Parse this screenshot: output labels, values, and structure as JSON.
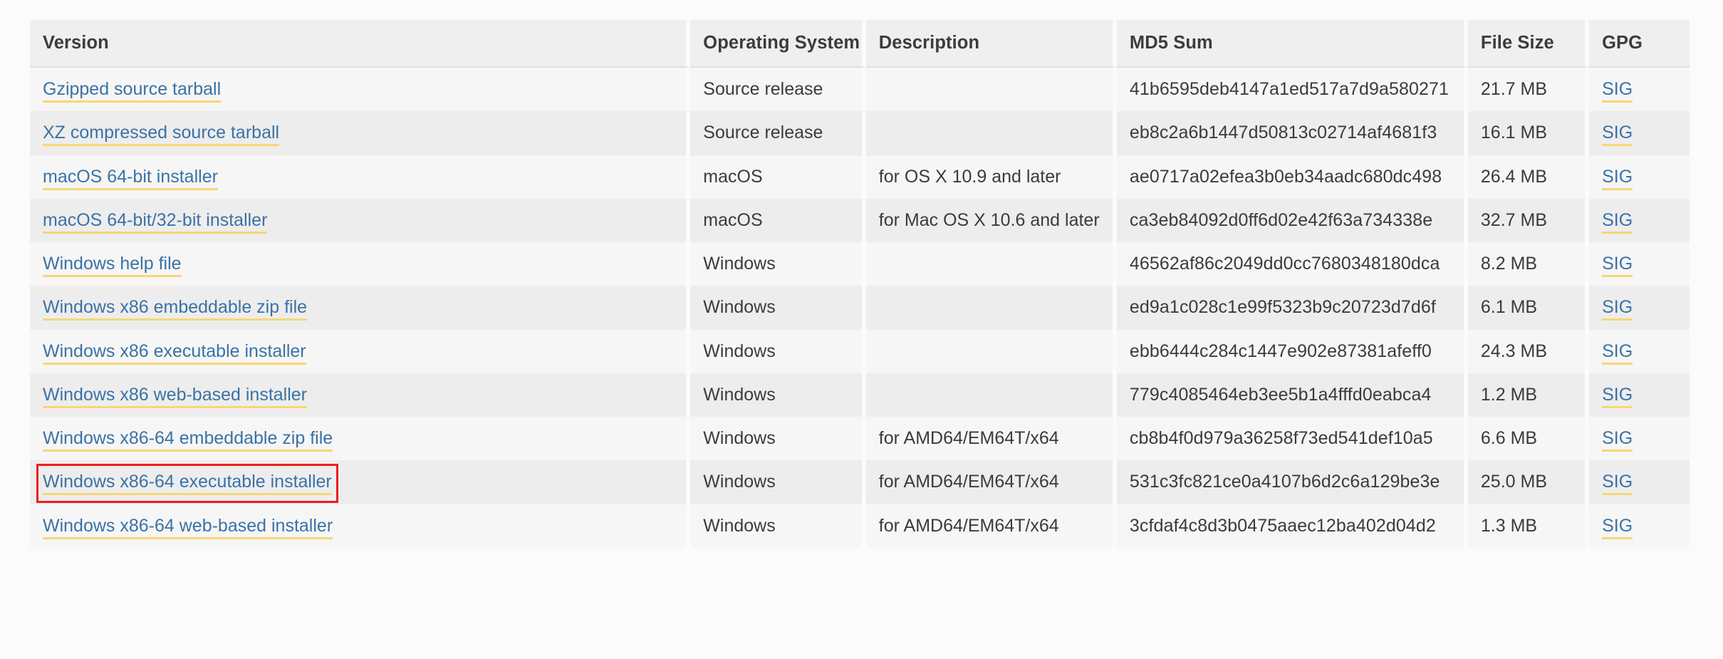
{
  "table": {
    "columns": [
      {
        "key": "version",
        "label": "Version"
      },
      {
        "key": "os",
        "label": "Operating System"
      },
      {
        "key": "description",
        "label": "Description"
      },
      {
        "key": "md5",
        "label": "MD5 Sum"
      },
      {
        "key": "size",
        "label": "File Size"
      },
      {
        "key": "gpg",
        "label": "GPG"
      }
    ],
    "rows": [
      {
        "version": "Gzipped source tarball",
        "os": "Source release",
        "description": "",
        "md5": "41b6595deb4147a1ed517a7d9a580271",
        "size": "21.7 MB",
        "gpg": "SIG"
      },
      {
        "version": "XZ compressed source tarball",
        "os": "Source release",
        "description": "",
        "md5": "eb8c2a6b1447d50813c02714af4681f3",
        "size": "16.1 MB",
        "gpg": "SIG"
      },
      {
        "version": "macOS 64-bit installer",
        "os": "macOS",
        "description": "for OS X 10.9 and later",
        "md5": "ae0717a02efea3b0eb34aadc680dc498",
        "size": "26.4 MB",
        "gpg": "SIG"
      },
      {
        "version": "macOS 64-bit/32-bit installer",
        "os": "macOS",
        "description": "for Mac OS X 10.6 and later",
        "md5": "ca3eb84092d0ff6d02e42f63a734338e",
        "size": "32.7 MB",
        "gpg": "SIG"
      },
      {
        "version": "Windows help file",
        "os": "Windows",
        "description": "",
        "md5": "46562af86c2049dd0cc7680348180dca",
        "size": "8.2 MB",
        "gpg": "SIG"
      },
      {
        "version": "Windows x86 embeddable zip file",
        "os": "Windows",
        "description": "",
        "md5": "ed9a1c028c1e99f5323b9c20723d7d6f",
        "size": "6.1 MB",
        "gpg": "SIG"
      },
      {
        "version": "Windows x86 executable installer",
        "os": "Windows",
        "description": "",
        "md5": "ebb6444c284c1447e902e87381afeff0",
        "size": "24.3 MB",
        "gpg": "SIG"
      },
      {
        "version": "Windows x86 web-based installer",
        "os": "Windows",
        "description": "",
        "md5": "779c4085464eb3ee5b1a4fffd0eabca4",
        "size": "1.2 MB",
        "gpg": "SIG"
      },
      {
        "version": "Windows x86-64 embeddable zip file",
        "os": "Windows",
        "description": "for AMD64/EM64T/x64",
        "md5": "cb8b4f0d979a36258f73ed541def10a5",
        "size": "6.6 MB",
        "gpg": "SIG"
      },
      {
        "version": "Windows x86-64 executable installer",
        "os": "Windows",
        "description": "for AMD64/EM64T/x64",
        "md5": "531c3fc821ce0a4107b6d2c6a129be3e",
        "size": "25.0 MB",
        "gpg": "SIG",
        "highlighted": true
      },
      {
        "version": "Windows x86-64 web-based installer",
        "os": "Windows",
        "description": "for AMD64/EM64T/x64",
        "md5": "3cfdaf4c8d3b0475aaec12ba402d04d2",
        "size": "1.3 MB",
        "gpg": "SIG"
      }
    ]
  },
  "colors": {
    "page_background": "#fbfbfb",
    "header_background": "#efeff0",
    "row_odd_background": "#f6f6f6",
    "row_even_background": "#ededee",
    "link_text": "#3b72a4",
    "link_underline": "#f7d772",
    "body_text": "#3b3b3b",
    "highlight_border": "#ee1d1d"
  }
}
